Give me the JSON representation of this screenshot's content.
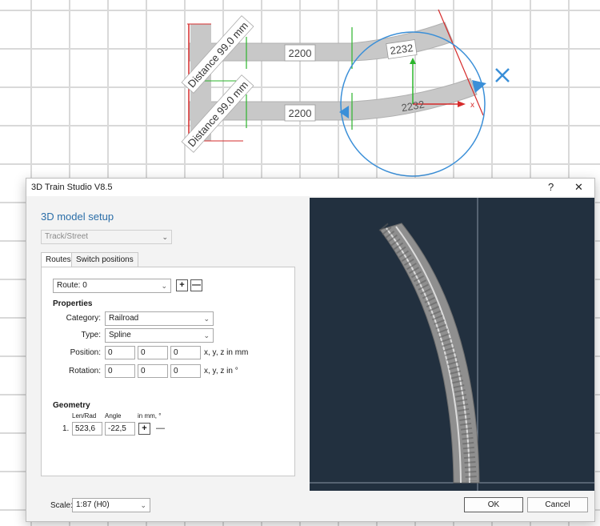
{
  "canvas": {
    "distance_label_1": "Distance 99.0 mm",
    "distance_label_2": "Distance 99.0 mm",
    "track_length_upper": "2200",
    "track_length_lower": "2200",
    "curve_length_upper": "2232",
    "curve_length_lower": "2232",
    "axis_x_label": "x",
    "colors": {
      "accent_blue": "#3a8fd8",
      "gizmo_red": "#d62b2b",
      "gizmo_green": "#2bb52b",
      "track_gray": "#c8c8c8"
    }
  },
  "dialog": {
    "title": "3D Train Studio V8.5",
    "help_label": "?",
    "close_label": "✕",
    "heading": "3D model setup",
    "model_type": "Track/Street",
    "tabs": [
      "Routes",
      "Switch positions"
    ],
    "route": {
      "selected": "Route: 0",
      "add_label": "+",
      "remove_label": "—"
    },
    "properties": {
      "heading": "Properties",
      "category_label": "Category:",
      "category_value": "Railroad",
      "type_label": "Type:",
      "type_value": "Spline",
      "position_label": "Position:",
      "position": [
        "0",
        "0",
        "0"
      ],
      "position_unit": "x, y, z in mm",
      "rotation_label": "Rotation:",
      "rotation": [
        "0",
        "0",
        "0"
      ],
      "rotation_unit": "x, y, z in °"
    },
    "geometry": {
      "heading": "Geometry",
      "col_len_rad": "Len/Rad",
      "col_angle": "Angle",
      "col_units": "in mm, °",
      "rows": [
        {
          "index": "1.",
          "len_rad": "523,6",
          "angle": "-22,5"
        }
      ],
      "add_label": "+",
      "remove_label": "—"
    },
    "footer": {
      "scale_label": "Scale:",
      "scale_value": "1:87 (H0)",
      "ok_label": "OK",
      "cancel_label": "Cancel"
    }
  }
}
